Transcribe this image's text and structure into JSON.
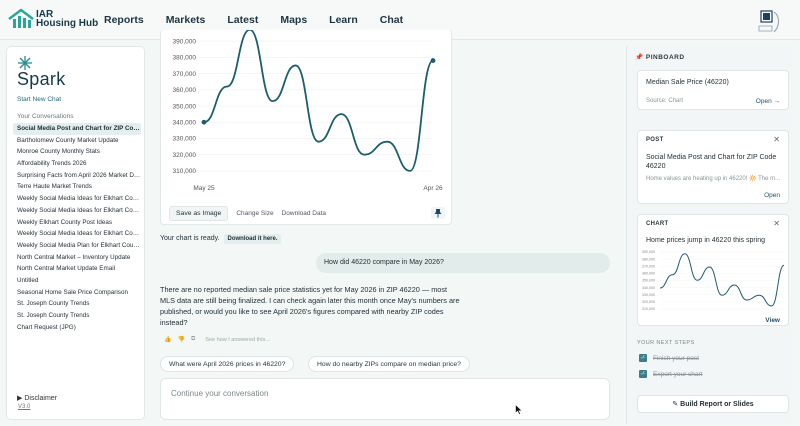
{
  "header": {
    "logo_line1": "IAR",
    "logo_line2": "Housing Hub",
    "nav": [
      "Reports",
      "Markets",
      "Latest",
      "Maps",
      "Learn",
      "Chat"
    ]
  },
  "sidebar": {
    "brand": "Spark",
    "new_chat": "Start New Chat",
    "conversations_title": "Your Conversations",
    "conversations": [
      "Social Media Post and Chart for ZIP Code 46220",
      "Bartholomew County Market Update",
      "Monroe County Monthly Stats",
      "Affordability Trends 2026",
      "Surprising Facts from April 2026 Market Data",
      "Terre Haute Market Trends",
      "Weekly Social Media Ideas for Elkhart County",
      "Weekly Social Media Ideas for Elkhart County",
      "Weekly Elkhart County Post Ideas",
      "Weekly Social Media Ideas for Elkhart County",
      "Weekly Social Media Plan for Elkhart County",
      "North Central Market – Inventory Update",
      "North Central Market Update Email",
      "Untitled",
      "Seasonal Home Sale Price Comparison",
      "St. Joseph County Trends",
      "St. Joseph County Trends",
      "Chart Request (JPG)"
    ],
    "disclaimer": "Disclaimer",
    "version": "V3.0"
  },
  "main": {
    "chart_actions": {
      "save": "Save as Image",
      "change_size": "Change Size",
      "download": "Download Data"
    },
    "ready_text": "Your chart is ready.",
    "download_link": "Download it here.",
    "user_message": "How did 46220 compare in May 2026?",
    "assistant_message": "There are no reported median sale price statistics yet for May 2026 in ZIP 46220 — most MLS data are still being finalized. I can check again later this month once May's numbers are published, or would you like to see April 2026's figures compared with nearby ZIP codes instead?",
    "how_answered": "See how I answered this...",
    "suggestions": [
      "What were April 2026 prices in 46220?",
      "How do nearby ZIPs compare on median price?"
    ],
    "composer_placeholder": "Continue your conversation"
  },
  "pinboard": {
    "title": "PINBOARD",
    "card1": {
      "title": "Median Sale Price (46220)",
      "source": "Source: Chart",
      "link": "Open →"
    },
    "card2": {
      "tag": "POST",
      "title": "Social Media Post and Chart for ZIP Code 46220",
      "snippet": "Home values are heating up in 46220! 🔆 The m...",
      "link": "Open"
    },
    "card3": {
      "tag": "CHART",
      "title": "Home prices jump in 46220 this spring",
      "link": "View"
    },
    "next_steps_title": "YOUR NEXT STEPS",
    "steps": [
      "Finish your post",
      "Export your chart"
    ],
    "build_button": "Build Report or Slides"
  },
  "chart_data": {
    "type": "line",
    "color": "#1d5e6b",
    "x_tick_labels": [
      "May 25",
      "Apr 26"
    ],
    "ylim": [
      305000,
      395000
    ],
    "y_ticks": [
      310000,
      320000,
      330000,
      340000,
      350000,
      360000,
      370000,
      380000,
      390000
    ],
    "y_tick_labels": [
      "310,000",
      "320,000",
      "330,000",
      "340,000",
      "350,000",
      "360,000",
      "370,000",
      "380,000",
      "390,000"
    ],
    "values": [
      340000,
      362000,
      397000,
      353000,
      375000,
      328000,
      345000,
      320000,
      328000,
      310000,
      378000
    ],
    "grid": "horizontal"
  },
  "mini_chart_data": {
    "type": "line",
    "values": [
      340000,
      362000,
      397000,
      353000,
      375000,
      328000,
      345000,
      320000,
      328000,
      310000,
      378000
    ],
    "ylim": [
      305000,
      400000
    ],
    "y_tick_labels": [
      "390,000",
      "380,000",
      "370,000",
      "360,000",
      "350,000",
      "340,000",
      "330,000",
      "320,000",
      "310,000"
    ]
  }
}
